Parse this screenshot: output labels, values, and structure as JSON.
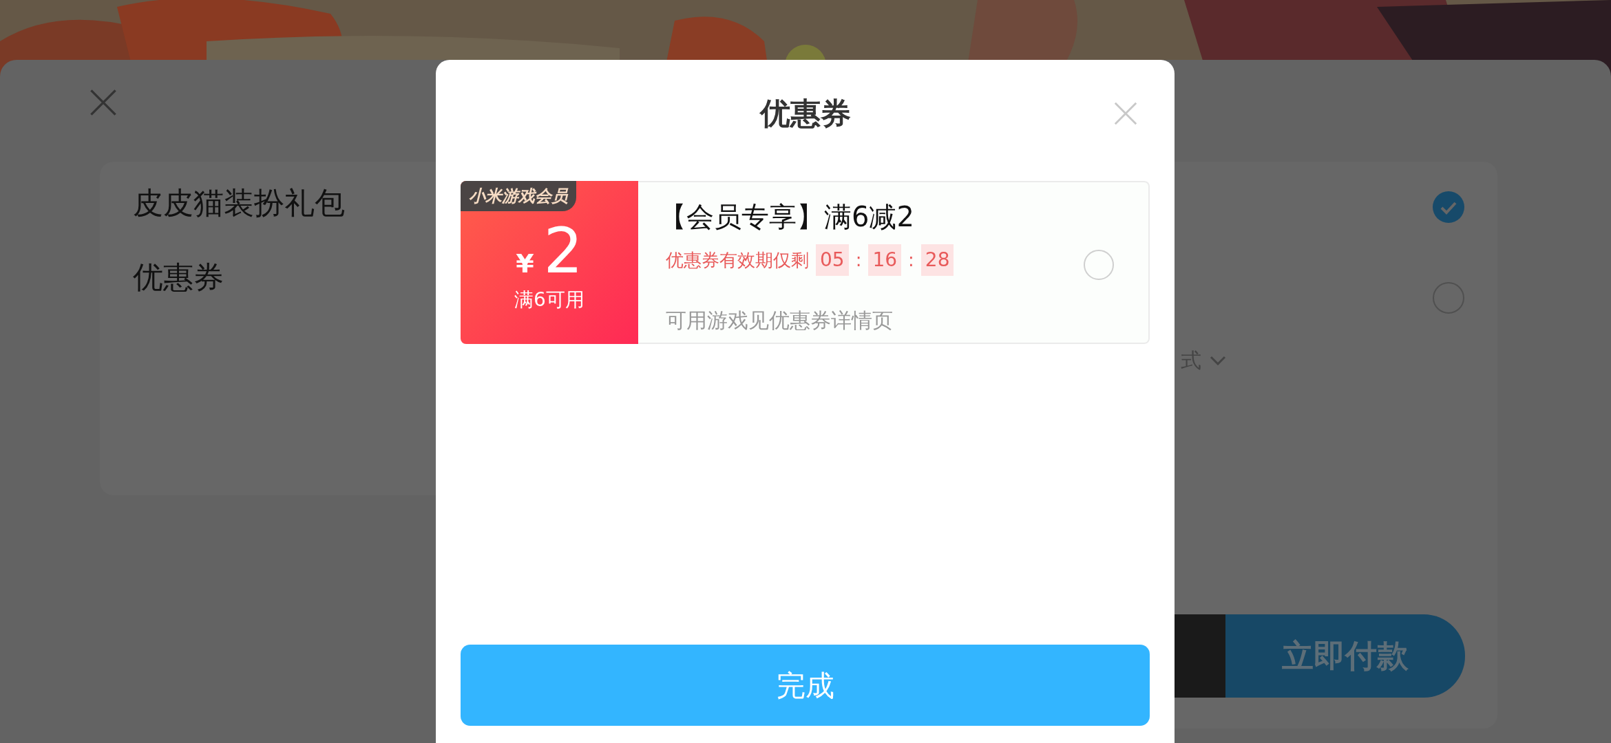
{
  "order_sheet": {
    "items": [
      {
        "label": "皮皮猫装扮礼包",
        "checked": true
      },
      {
        "label": "优惠券",
        "checked": false
      }
    ],
    "payment_method_fragment": "式",
    "pay_button": "立即付款"
  },
  "coupon_dialog": {
    "title": "优惠券",
    "coupons": [
      {
        "badge": "小米游戏会员",
        "currency": "¥",
        "amount": "2",
        "condition": "满6可用",
        "title": "【会员专享】满6减2",
        "expiry_label": "优惠券有效期仅剩",
        "countdown": [
          {
            "kind": "unit",
            "text": "05"
          },
          {
            "kind": "separator",
            "text": ":"
          },
          {
            "kind": "unit",
            "text": "16"
          },
          {
            "kind": "separator",
            "text": ":"
          },
          {
            "kind": "unit",
            "text": "28"
          }
        ],
        "note": "可用游戏见优惠券详情页",
        "selected": false
      }
    ],
    "done_button": "完成"
  }
}
